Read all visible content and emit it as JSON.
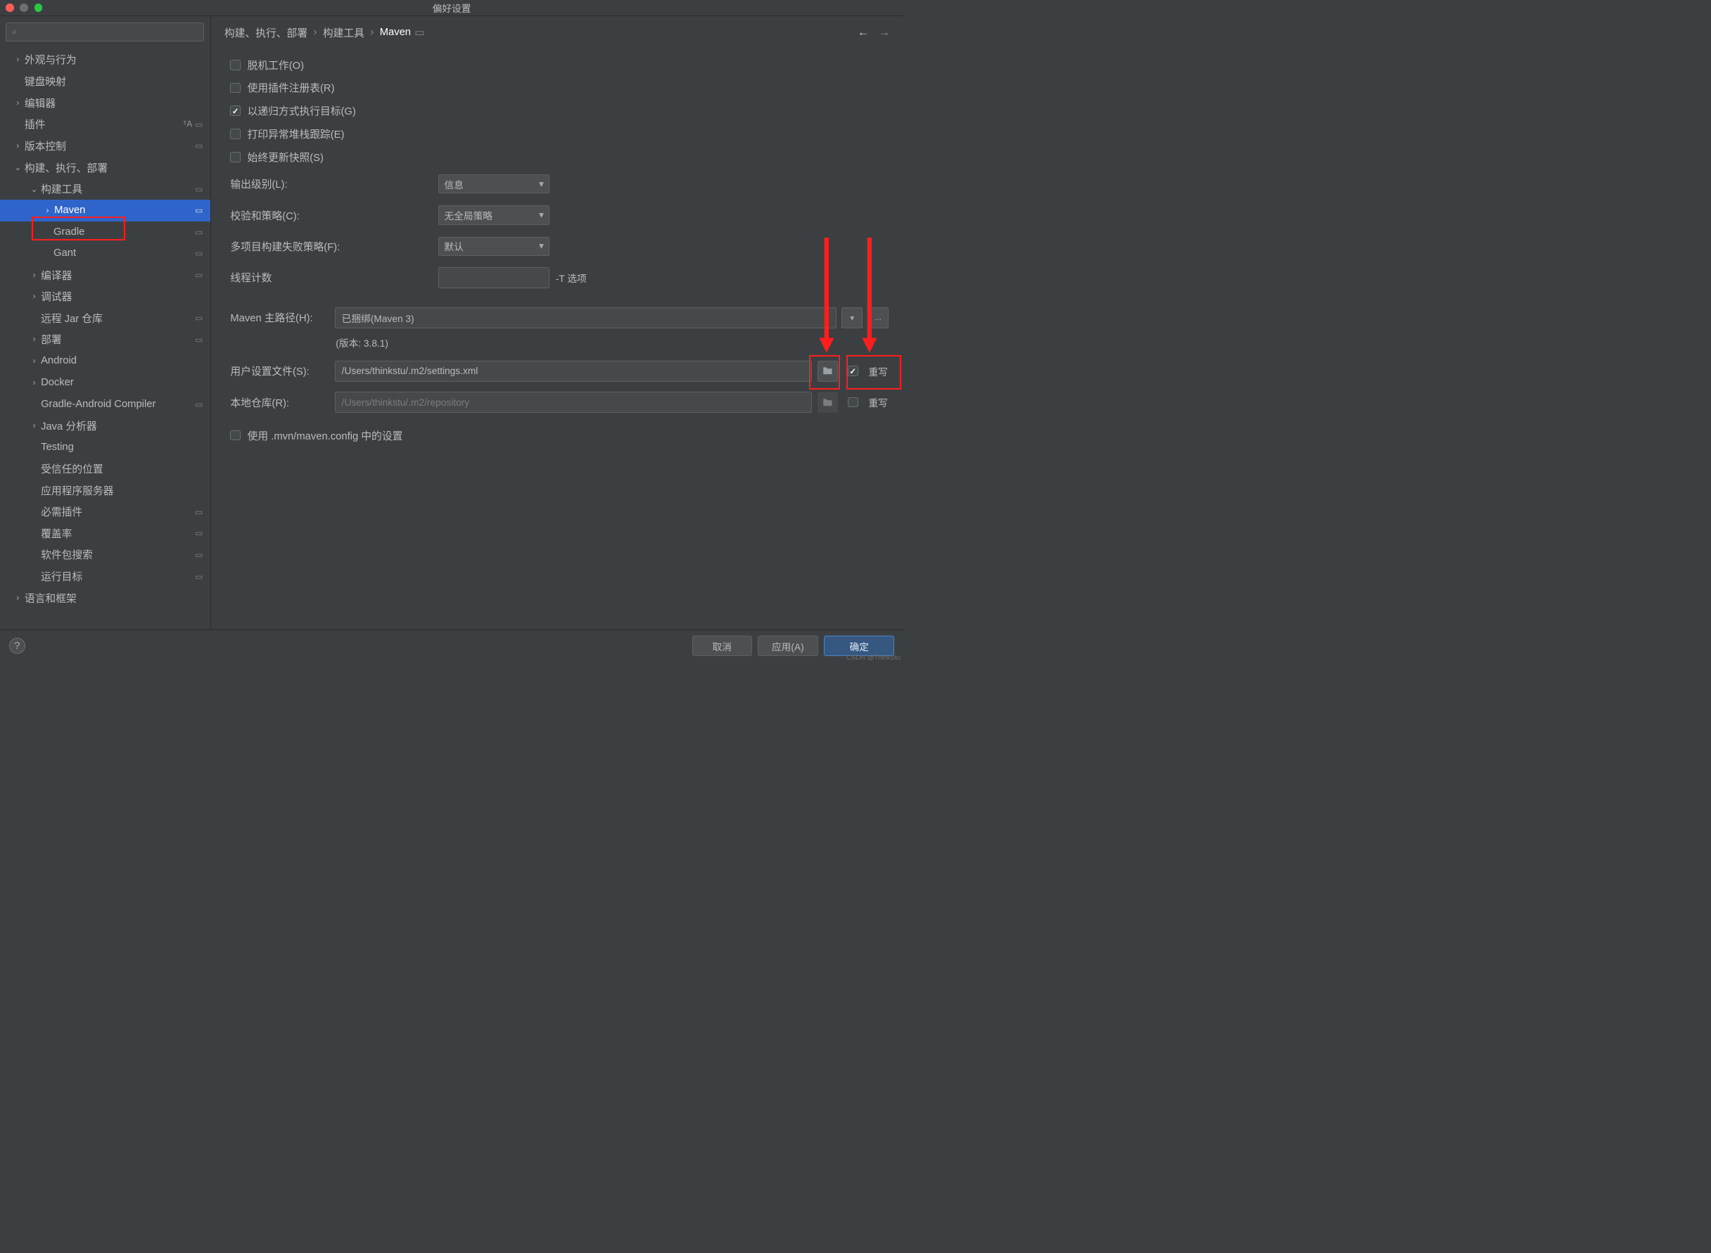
{
  "window_title": "偏好设置",
  "breadcrumb": {
    "c1": "构建、执行、部署",
    "c2": "构建工具",
    "c3": "Maven"
  },
  "sidebar": {
    "items": [
      {
        "label": "外观与行为"
      },
      {
        "label": "键盘映射"
      },
      {
        "label": "编辑器"
      },
      {
        "label": "插件"
      },
      {
        "label": "版本控制"
      },
      {
        "label": "构建、执行、部署"
      },
      {
        "label": "构建工具"
      },
      {
        "label": "Maven"
      },
      {
        "label": "Gradle"
      },
      {
        "label": "Gant"
      },
      {
        "label": "编译器"
      },
      {
        "label": "调试器"
      },
      {
        "label": "远程 Jar 仓库"
      },
      {
        "label": "部署"
      },
      {
        "label": "Android"
      },
      {
        "label": "Docker"
      },
      {
        "label": "Gradle-Android Compiler"
      },
      {
        "label": "Java 分析器"
      },
      {
        "label": "Testing"
      },
      {
        "label": "受信任的位置"
      },
      {
        "label": "应用程序服务器"
      },
      {
        "label": "必需插件"
      },
      {
        "label": "覆盖率"
      },
      {
        "label": "软件包搜索"
      },
      {
        "label": "运行目标"
      },
      {
        "label": "语言和框架"
      }
    ]
  },
  "options": {
    "offline": "脱机工作(O)",
    "plugin_registry": "使用插件注册表(R)",
    "recursive": "以递归方式执行目标(G)",
    "stacktrace": "打印异常堆栈跟踪(E)",
    "update_snapshots": "始终更新快照(S)"
  },
  "fields": {
    "output_level_label": "输出级别(L):",
    "output_level_value": "信息",
    "checksum_label": "校验和策略(C):",
    "checksum_value": "无全局策略",
    "fail_label": "多项目构建失败策略(F):",
    "fail_value": "默认",
    "threads_label": "线程计数",
    "threads_suffix": "-T 选项",
    "maven_home_label": "Maven 主路径(H):",
    "maven_home_value": "已捆绑(Maven 3)",
    "maven_home_note": "(版本: 3.8.1)",
    "user_settings_label": "用户设置文件(S):",
    "user_settings_value": "/Users/thinkstu/.m2/settings.xml",
    "local_repo_label": "本地仓库(R):",
    "local_repo_placeholder": "/Users/thinkstu/.m2/repository",
    "override": "重写",
    "use_mvn_config": "使用 .mvn/maven.config 中的设置",
    "more_btn": "..."
  },
  "footer": {
    "cancel": "取消",
    "apply": "应用(A)",
    "ok": "确定"
  },
  "watermark": "CSDN @ThinkStu"
}
